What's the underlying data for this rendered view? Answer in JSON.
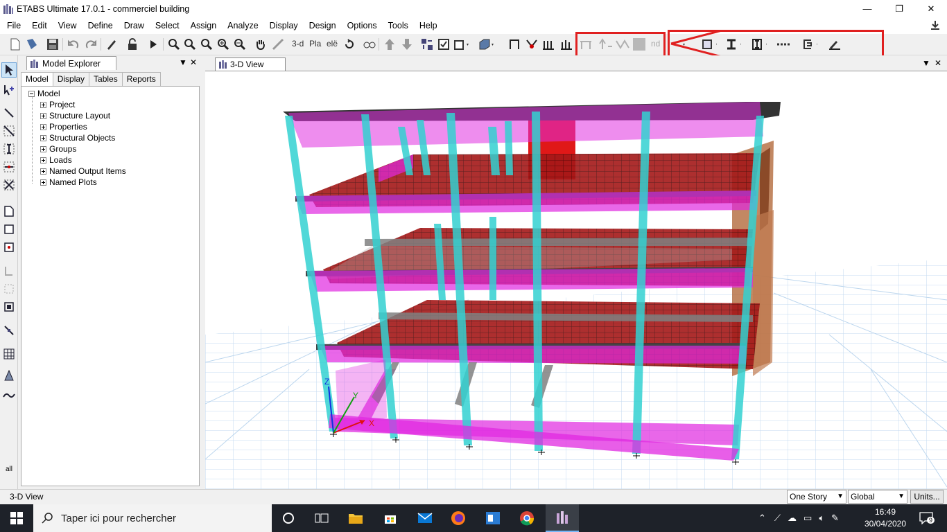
{
  "window": {
    "title": "ETABS Ultimate 17.0.1 - commerciel building",
    "minimize": "—",
    "maximize": "❐",
    "close": "✕"
  },
  "menu": {
    "items": [
      "File",
      "Edit",
      "View",
      "Define",
      "Draw",
      "Select",
      "Assign",
      "Analyze",
      "Display",
      "Design",
      "Options",
      "Tools",
      "Help"
    ]
  },
  "toolbar": {
    "view_3d_label": "3-d",
    "plan_label": "Pla",
    "elev_label": "elë",
    "disabled_nd_label": "nd"
  },
  "explorer": {
    "title": "Model Explorer",
    "tabs": [
      "Model",
      "Display",
      "Tables",
      "Reports"
    ],
    "active_tab": "Model",
    "root": "Model",
    "nodes": [
      "Project",
      "Structure Layout",
      "Properties",
      "Structural Objects",
      "Groups",
      "Loads",
      "Named Output Items",
      "Named Plots"
    ]
  },
  "view": {
    "tab_label": "3-D View",
    "axis_x": "X",
    "axis_y": "Y",
    "axis_z": "Z"
  },
  "statusbar": {
    "text": "3-D View",
    "story_select": "One Story",
    "coord_select": "Global",
    "units_button": "Units...",
    "all_label": "all"
  },
  "taskbar": {
    "search_placeholder": "Taper ici pour rechercher",
    "time": "16:49",
    "date": "30/04/2020",
    "notifications": "9"
  },
  "colors": {
    "column": "#33d1d1",
    "beam": "#e020e0",
    "slab": "#b01818",
    "highlight": "#e02020",
    "grid": "#b8d4ec"
  }
}
